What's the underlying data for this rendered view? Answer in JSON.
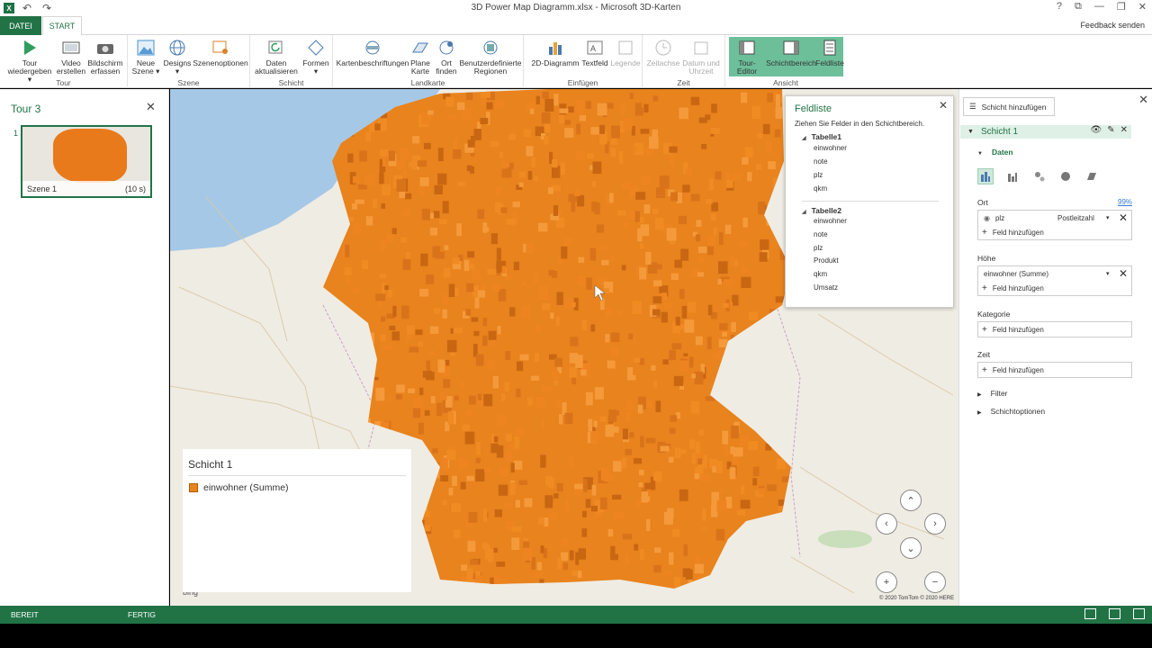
{
  "window": {
    "title": "3D Power Map Diagramm.xlsx - Microsoft 3D-Karten",
    "controls": [
      "?",
      "⧉",
      "—",
      "❐",
      "✕"
    ]
  },
  "tabs": {
    "file": "DATEI",
    "start": "START",
    "feedback": "Feedback senden"
  },
  "ribbon": {
    "groups": {
      "tour": "Tour",
      "szene": "Szene",
      "schicht": "Schicht",
      "landkarte": "Landkarte",
      "einfuegen": "Einfügen",
      "zeit": "Zeit",
      "ansicht": "Ansicht"
    },
    "buttons": {
      "play": "Tour\nwiedergeben ▾",
      "video": "Video\nerstellen",
      "capture": "Bildschirm\nerfassen",
      "new_scene": "Neue\nSzene ▾",
      "designs": "Designs\n▾",
      "scene_options": "Szenenoptionen",
      "refresh": "Daten\naktualisieren",
      "shapes": "Formen\n▾",
      "map_labels": "Kartenbeschriftungen",
      "flat_map": "Plane\nKarte",
      "find_location": "Ort\nfinden",
      "custom_regions": "Benutzerdefinierte\nRegionen",
      "chart_2d": "2D-Diagramm",
      "textbox": "Textfeld",
      "legend": "Legende",
      "timeline": "Zeitachse",
      "date_time": "Datum und\nUhrzeit",
      "tour_editor": "Tour-Editor",
      "layer_pane": "Schichtbereich",
      "field_list": "Feldliste"
    }
  },
  "tour_pane": {
    "title": "Tour 3",
    "scene_number": "1",
    "scene_name": "Szene 1",
    "scene_duration": "(10 s)"
  },
  "field_list": {
    "title": "Feldliste",
    "hint": "Ziehen Sie Felder in den Schichtbereich.",
    "tables": [
      {
        "name": "Tabelle1",
        "fields": [
          "einwohner",
          "note",
          "plz",
          "qkm"
        ]
      },
      {
        "name": "Tabelle2",
        "fields": [
          "einwohner",
          "note",
          "plz",
          "Produkt",
          "qkm",
          "Umsatz"
        ]
      }
    ]
  },
  "legend": {
    "title": "Schicht 1",
    "series": "einwohner (Summe)",
    "color": "#e8831d"
  },
  "map": {
    "attribution": "© 2020 TomTom © 2020 HERE",
    "bing_label": "bing",
    "nav": {
      "up": "⌃",
      "left": "‹",
      "right": "›",
      "down": "⌄",
      "zoom_in": "+",
      "zoom_out": "−"
    },
    "colors": {
      "water": "#a5c8e6",
      "land": "#efece4",
      "columns": "#e8831d"
    }
  },
  "layer_pane": {
    "add_layer": "Schicht hinzufügen",
    "layer_name": "Schicht 1",
    "data_section": "Daten",
    "location": {
      "label": "Ort",
      "match": "99%",
      "field": "plz",
      "type": "Postleitzahl",
      "add": "Feld hinzufügen"
    },
    "height": {
      "label": "Höhe",
      "field": "einwohner (Summe)",
      "add": "Feld hinzufügen"
    },
    "category": {
      "label": "Kategorie",
      "add": "Feld hinzufügen"
    },
    "time": {
      "label": "Zeit",
      "add": "Feld hinzufügen"
    },
    "filter": "Filter",
    "layer_options": "Schichtoptionen"
  },
  "status": {
    "ready": "BEREIT",
    "done": "FERTIG"
  }
}
